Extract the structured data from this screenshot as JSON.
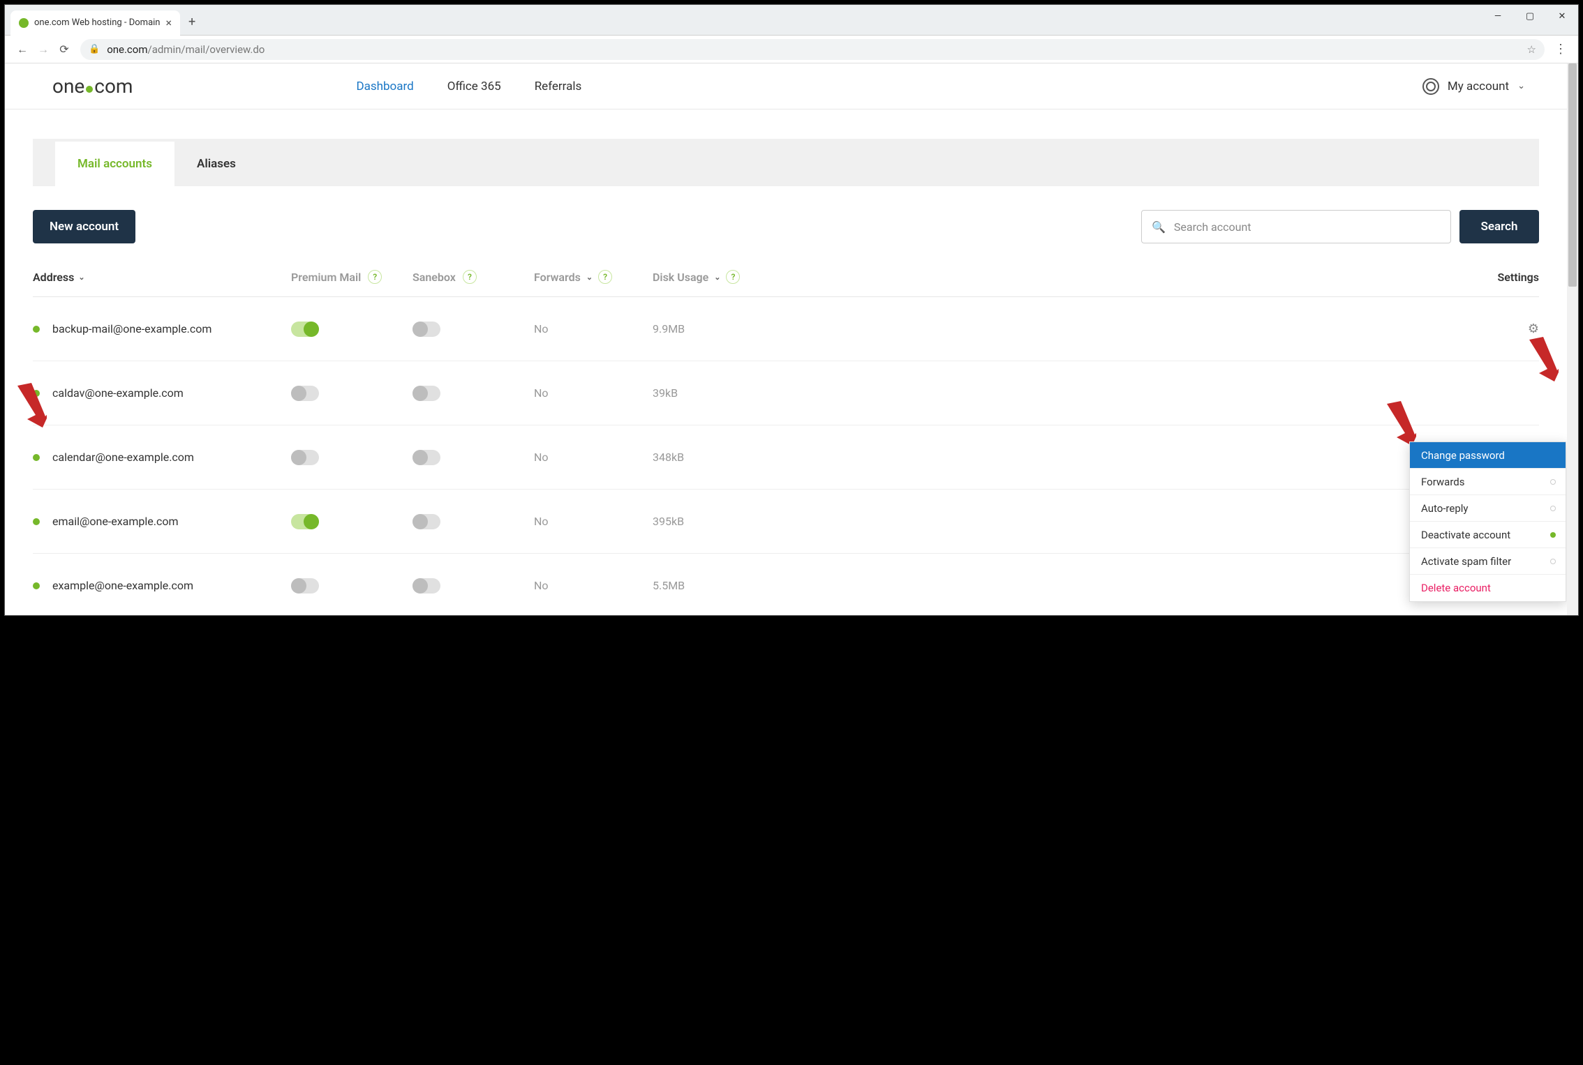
{
  "window": {
    "tab_title": "one.com Web hosting  -  Domain",
    "url_domain": "one.com",
    "url_path": "/admin/mail/overview.do"
  },
  "header": {
    "logo_left": "one",
    "logo_right": "com",
    "nav": {
      "dashboard": "Dashboard",
      "office": "Office 365",
      "referrals": "Referrals"
    },
    "account": "My account"
  },
  "tabs": {
    "mail": "Mail accounts",
    "aliases": "Aliases"
  },
  "toolbar": {
    "new_account": "New account",
    "search_placeholder": "Search account",
    "search_button": "Search"
  },
  "columns": {
    "address": "Address",
    "premium": "Premium Mail",
    "sanebox": "Sanebox",
    "forwards": "Forwards",
    "disk": "Disk Usage",
    "settings": "Settings"
  },
  "rows": [
    {
      "email": "backup-mail@one-example.com",
      "premium": true,
      "sanebox": false,
      "forwards": "No",
      "disk": "9.9MB"
    },
    {
      "email": "caldav@one-example.com",
      "premium": false,
      "sanebox": false,
      "forwards": "No",
      "disk": "39kB"
    },
    {
      "email": "calendar@one-example.com",
      "premium": false,
      "sanebox": false,
      "forwards": "No",
      "disk": "348kB"
    },
    {
      "email": "email@one-example.com",
      "premium": true,
      "sanebox": false,
      "forwards": "No",
      "disk": "395kB"
    },
    {
      "email": "example@one-example.com",
      "premium": false,
      "sanebox": false,
      "forwards": "No",
      "disk": "5.5MB"
    }
  ],
  "dropdown": {
    "change_password": "Change password",
    "forwards": "Forwards",
    "auto_reply": "Auto-reply",
    "deactivate": "Deactivate account",
    "spam": "Activate spam filter",
    "delete": "Delete account"
  }
}
